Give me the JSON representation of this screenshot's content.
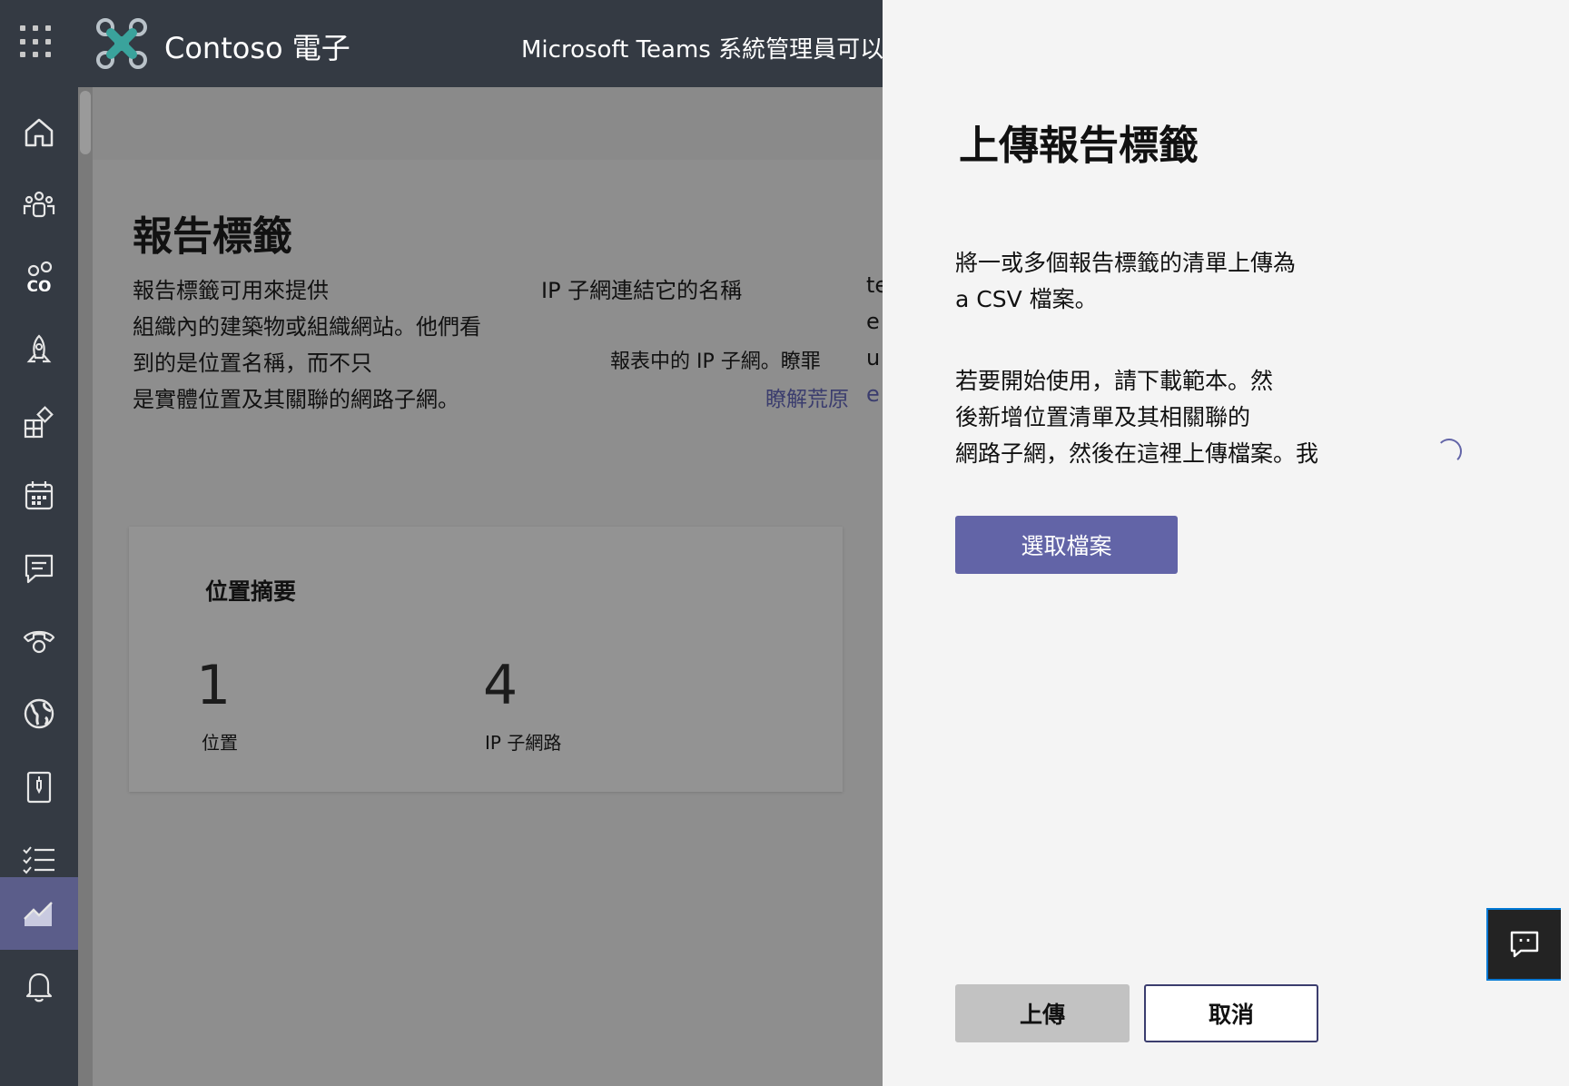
{
  "topbar": {
    "org_name": "Contoso 電子",
    "title": "Microsoft Teams 系統管理員可以"
  },
  "rail": {
    "items": [
      {
        "icon": "home-icon"
      },
      {
        "icon": "teams-icon"
      },
      {
        "icon": "users-icon",
        "label": "CO"
      },
      {
        "icon": "deployment-icon"
      },
      {
        "icon": "apps-icon"
      },
      {
        "icon": "meetings-icon"
      },
      {
        "icon": "messaging-icon"
      },
      {
        "icon": "voice-icon"
      },
      {
        "icon": "locations-icon"
      },
      {
        "icon": "policy-packages-icon"
      },
      {
        "icon": "planning-icon"
      },
      {
        "icon": "analytics-icon",
        "active": true
      },
      {
        "icon": "notifications-icon"
      }
    ]
  },
  "main": {
    "page_title": "報告標籤",
    "description": {
      "col1": [
        "報告標籤可用來提供",
        "組織內的建築物或組織網站。他們看",
        "到的是位置名稱，而不只",
        "是實體位置及其關聯的網路子網。"
      ],
      "col2_line1": "IP 子網連結它的名稱",
      "col2_line3": "報表中的 IP 子網。瞭罪",
      "col2_line4": "瞭解荒原",
      "col3": [
        "te",
        "e",
        "u",
        "e"
      ]
    },
    "summary_card": {
      "title": "位置摘要",
      "stats": [
        {
          "value": "1",
          "label": "位置"
        },
        {
          "value": "4",
          "label": "IP 子網路"
        }
      ]
    }
  },
  "panel": {
    "title": "上傳報告標籤",
    "para1": [
      "將一或多個報告標籤的清單上傳為",
      "a CSV 檔案。"
    ],
    "para2": [
      "若要開始使用，請下載範本。然",
      "後新增位置清單及其相關聯的",
      "網路子網，然後在這裡上傳檔案。我"
    ],
    "choose_file_label": "選取檔案",
    "upload_label": "上傳",
    "cancel_label": "取消"
  },
  "colors": {
    "topbar": "#343a43",
    "accent": "#6264a7",
    "rail_active": "#5b5d8a",
    "panel_bg": "#f4f4f4"
  }
}
